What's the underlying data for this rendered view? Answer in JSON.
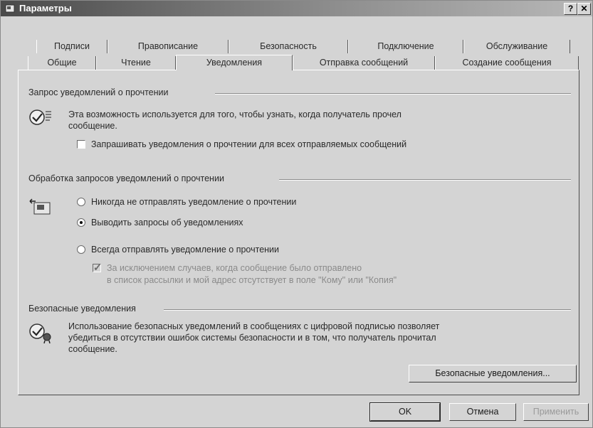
{
  "window": {
    "title": "Параметры",
    "help": "?",
    "close": "✕"
  },
  "tabs": {
    "row_back": [
      "Подписи",
      "Правописание",
      "Безопасность",
      "Подключение",
      "Обслуживание"
    ],
    "row_front": [
      "Общие",
      "Чтение",
      "Уведомления",
      "Отправка сообщений",
      "Создание сообщения"
    ],
    "active": "Уведомления"
  },
  "read_receipts": {
    "header": "Запрос уведомлений о прочтении",
    "description_line1": "Эта возможность используется для того, чтобы узнать, когда получатель прочел",
    "description_line2": "сообщение.",
    "checkbox_label": "Запрашивать уведомления о прочтении для всех отправляемых сообщений",
    "checkbox_checked": false
  },
  "returning": {
    "header": "Обработка запросов уведомлений о прочтении",
    "options": [
      "Никогда не отправлять уведомление о прочтении",
      "Выводить запросы об уведомлениях",
      "Всегда отправлять уведомление о прочтении"
    ],
    "selected": 1,
    "except_line1": "За исключением случаев, когда сообщение было отправлено",
    "except_line2": "в список рассылки и мой адрес отсутствует в поле \"Кому\" или \"Копия\"",
    "except_checked": true,
    "except_enabled": false
  },
  "secure": {
    "header": "Безопасные уведомления",
    "line1": "Использование безопасных уведомлений в сообщениях с цифровой подписью позволяет",
    "line2": "убедиться в отсутствии ошибок системы безопасности и в том, что получатель прочитал",
    "line3": "сообщение.",
    "button": "Безопасные уведомления..."
  },
  "footer": {
    "ok": "OK",
    "cancel": "Отмена",
    "apply": "Применить"
  }
}
